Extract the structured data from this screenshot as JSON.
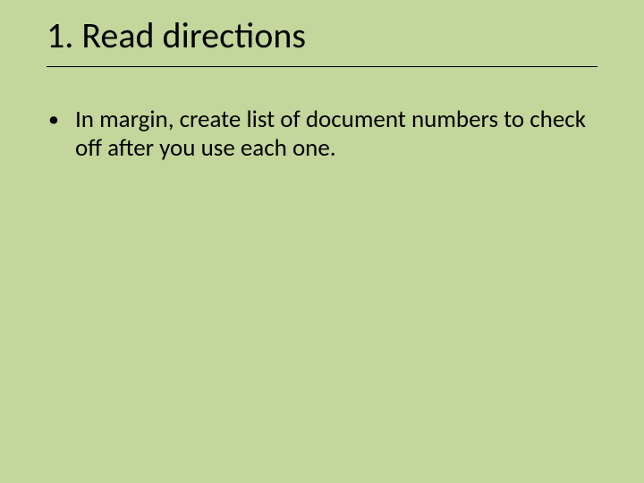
{
  "colors": {
    "background": "#c3d69b",
    "text": "#000000"
  },
  "title": "1. Read directions",
  "bullets": [
    {
      "text": "In margin, create list of document numbers to check off after you use each one."
    }
  ],
  "bullet_glyph": "•"
}
